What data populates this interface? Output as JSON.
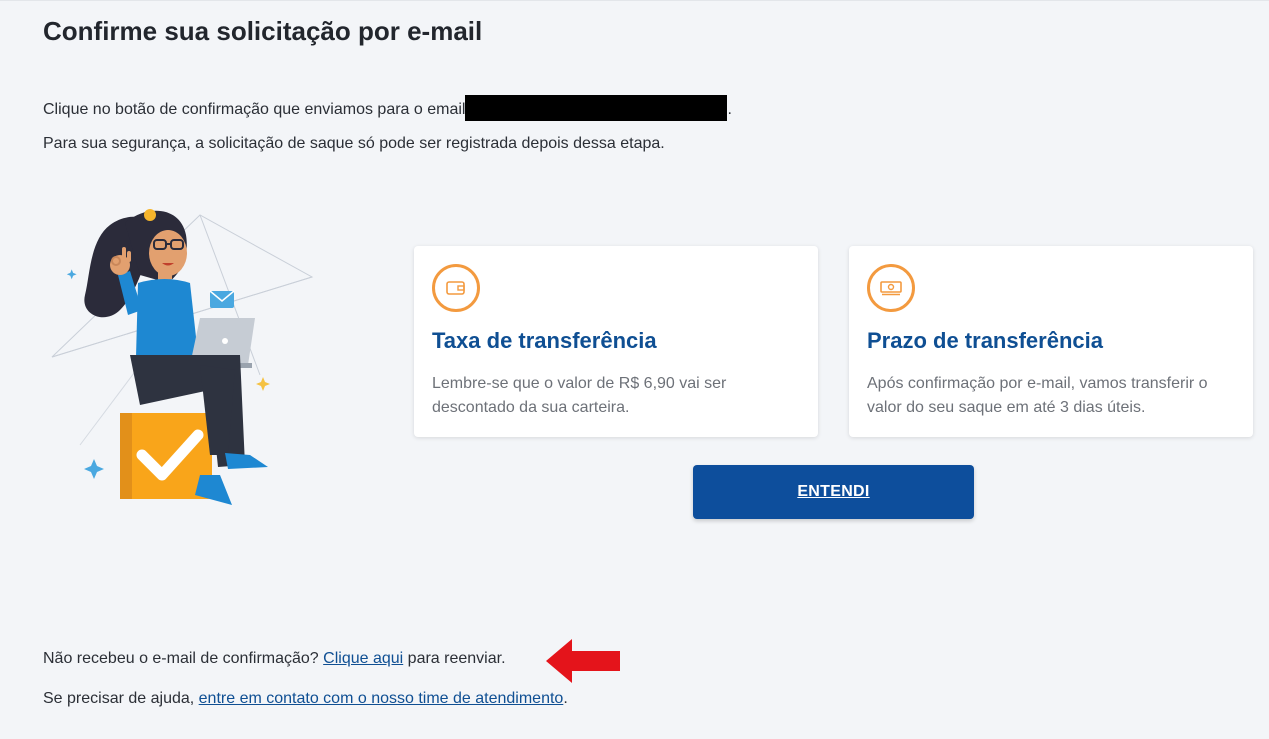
{
  "header": {
    "title": "Confirme sua solicitação por e-mail"
  },
  "intro": {
    "line1_prefix": "Clique no botão de confirmação que enviamos para o email",
    "line1_suffix": ".",
    "line2": "Para sua segurança, a solicitação de saque só pode ser registrada depois dessa etapa."
  },
  "cards": [
    {
      "icon": "wallet-icon",
      "title": "Taxa de transferência",
      "text": "Lembre-se que o valor de R$ 6,90 vai ser descontado da sua carteira."
    },
    {
      "icon": "money-icon",
      "title": "Prazo de transferência",
      "text": "Após confirmação por e-mail, vamos transferir o valor do seu saque em até 3 dias úteis."
    }
  ],
  "cta": {
    "label": "ENTENDI"
  },
  "footer": {
    "resend_prefix": "Não recebeu o e-mail de confirmação?",
    "resend_link": "Clique aqui",
    "resend_suffix": "para reenviar.",
    "help_prefix": "Se precisar de ajuda,",
    "help_link": "entre em contato com o nosso time de atendimento",
    "help_suffix": "."
  },
  "colors": {
    "background": "#f3f5f8",
    "primary": "#0d4e9c",
    "accent_orange": "#f39a3f",
    "annotation_red": "#e4141b"
  }
}
